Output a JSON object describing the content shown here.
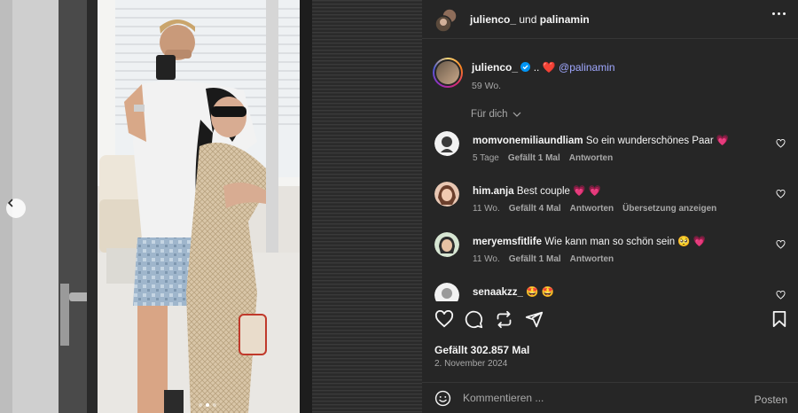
{
  "post": {
    "header": {
      "user1": "julienco_",
      "conjunction": "und",
      "user2": "palinamin"
    },
    "caption": {
      "username": "julienco_",
      "verified_icon": "verified-badge-icon",
      "text_dots": "..",
      "emoji": "❤️",
      "mention": "@palinamin",
      "time": "59 Wo."
    },
    "sort_label": "Für dich",
    "comments": [
      {
        "username": "momvonemiliaundliam",
        "text": "So ein wunderschönes Paar",
        "emoji": "💗",
        "time": "5 Tage",
        "likes": "Gefällt 1 Mal",
        "reply": "Antworten",
        "translate": ""
      },
      {
        "username": "him.anja",
        "text": "Best couple",
        "emoji": "💗 💗",
        "time": "11 Wo.",
        "likes": "Gefällt 4 Mal",
        "reply": "Antworten",
        "translate": "Übersetzung anzeigen"
      },
      {
        "username": "meryemsfitlife",
        "text": "Wie kann man so schön sein",
        "emoji": "🥺 💗",
        "time": "11 Wo.",
        "likes": "Gefällt 1 Mal",
        "reply": "Antworten",
        "translate": ""
      },
      {
        "username": "senaakzz_",
        "text": "",
        "emoji": "🤩 🤩",
        "time": "",
        "likes": "",
        "reply": "",
        "translate": ""
      }
    ],
    "likes_count": "Gefällt 302.857 Mal",
    "date": "2. November 2024",
    "composer": {
      "placeholder": "Kommentieren ...",
      "post_label": "Posten"
    },
    "carousel": {
      "total": 3,
      "active": 2
    }
  },
  "colors": {
    "panel_bg": "#262626",
    "mention": "#a0a8ff",
    "heart": "#ff3040",
    "muted_text": "#a8a8a8"
  }
}
